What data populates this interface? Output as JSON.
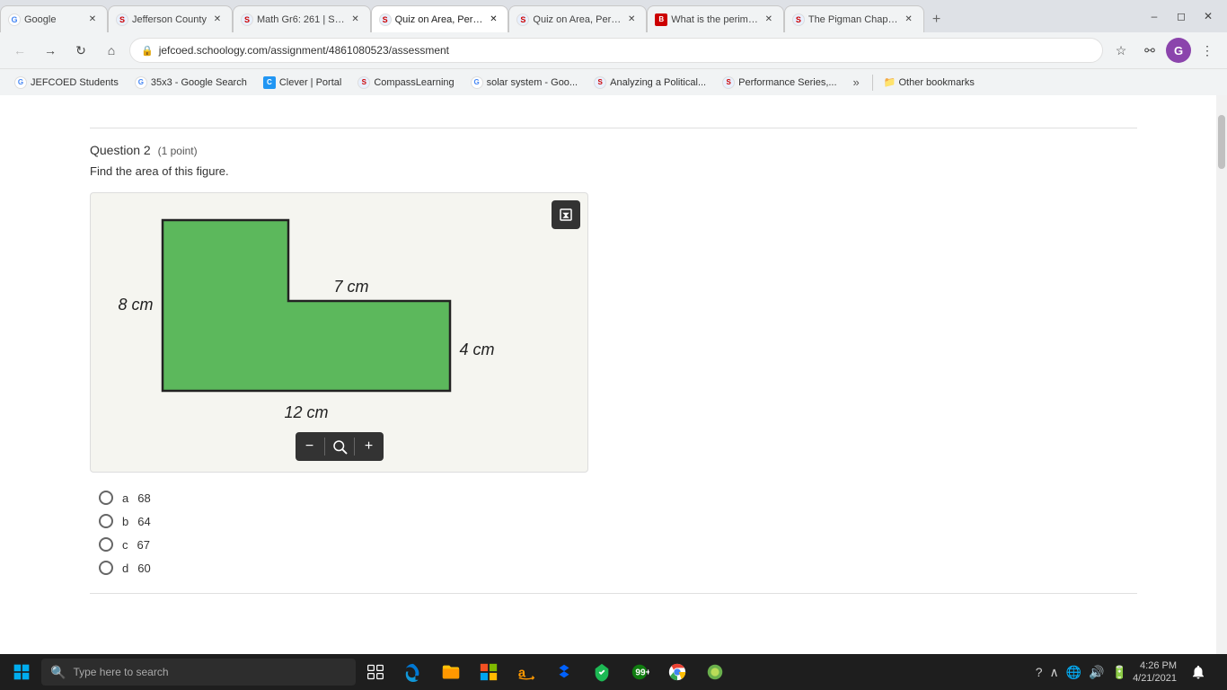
{
  "browser": {
    "tabs": [
      {
        "id": "tab1",
        "label": "Google",
        "favicon_type": "g",
        "active": false
      },
      {
        "id": "tab2",
        "label": "Jefferson County",
        "favicon_type": "s",
        "active": false
      },
      {
        "id": "tab3",
        "label": "Math Gr6: 261 | S…",
        "favicon_type": "s",
        "active": false
      },
      {
        "id": "tab4",
        "label": "Quiz on Area, Per…",
        "favicon_type": "s",
        "active": true
      },
      {
        "id": "tab5",
        "label": "Quiz on Area, Per…",
        "favicon_type": "s",
        "active": false
      },
      {
        "id": "tab6",
        "label": "What is the perim…",
        "favicon_type": "b",
        "active": false
      },
      {
        "id": "tab7",
        "label": "The Pigman Chap…",
        "favicon_type": "s",
        "active": false
      }
    ],
    "url": "jefcoed.schoology.com/assignment/4861080523/assessment",
    "bookmarks": [
      {
        "label": "JEFCOED Students",
        "favicon_type": "g"
      },
      {
        "label": "35x3 - Google Search",
        "favicon_type": "g"
      },
      {
        "label": "Clever | Portal",
        "favicon_type": "c"
      },
      {
        "label": "CompassLearning",
        "favicon_type": "s"
      },
      {
        "label": "solar system - Goo...",
        "favicon_type": "g"
      },
      {
        "label": "Analyzing a Political...",
        "favicon_type": "s"
      },
      {
        "label": "Performance Series,...",
        "favicon_type": "s"
      }
    ],
    "other_bookmarks_label": "Other bookmarks"
  },
  "question": {
    "number": "Question 2",
    "points": "(1 point)",
    "text": "Find the area of this figure.",
    "figure": {
      "label1": "7 cm",
      "label2": "8 cm",
      "label3": "4 cm",
      "label4": "12 cm"
    },
    "choices": [
      {
        "letter": "a",
        "value": "68"
      },
      {
        "letter": "b",
        "value": "64"
      },
      {
        "letter": "c",
        "value": "67"
      },
      {
        "letter": "d",
        "value": "60"
      }
    ]
  },
  "taskbar": {
    "search_placeholder": "Type here to search",
    "time": "4:26 PM",
    "date": "4/21/2021"
  },
  "icons": {
    "expand": "⤢",
    "zoom_minus": "−",
    "zoom_lens": "🔍",
    "zoom_plus": "+",
    "back": "←",
    "forward": "→",
    "reload": "↻",
    "home": "⌂",
    "star": "☆",
    "more": "⋮",
    "windows_start": "⊞",
    "search_taskbar": "🔍",
    "chevron_down": "›",
    "bookmarks_more": "»"
  }
}
